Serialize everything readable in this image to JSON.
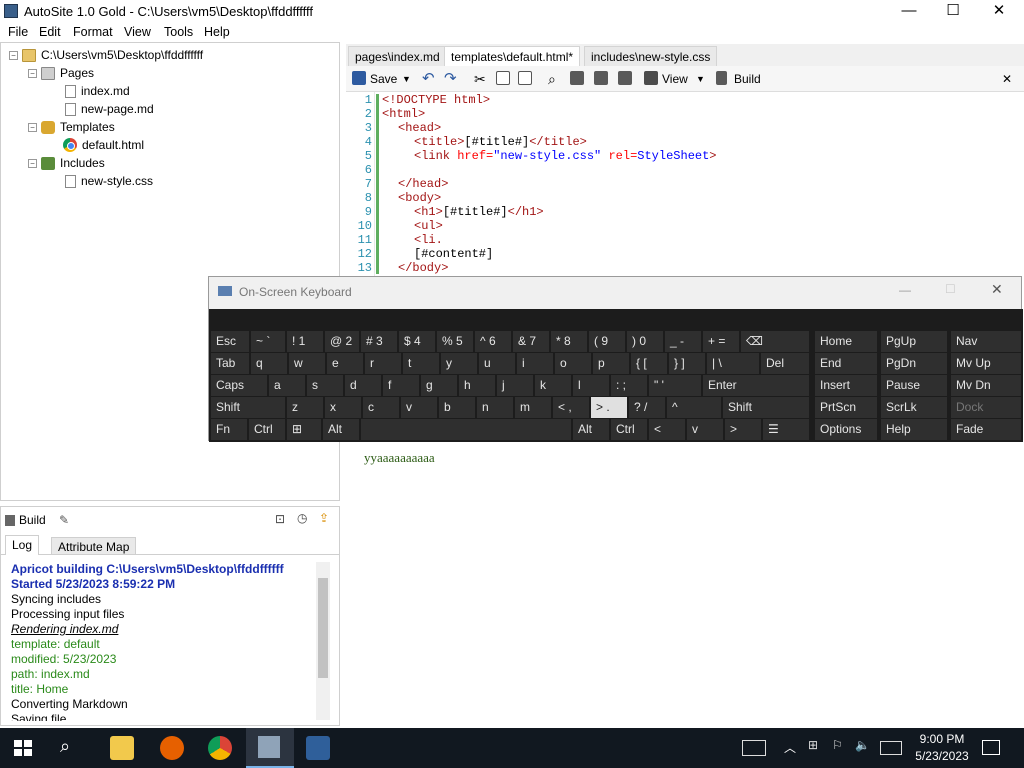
{
  "window": {
    "title": "AutoSite 1.0 Gold - C:\\Users\\vm5\\Desktop\\ffddffffff",
    "min": "—",
    "max": "☐",
    "close": "✕"
  },
  "menu": [
    "File",
    "Edit",
    "Format",
    "View",
    "Tools",
    "Help"
  ],
  "tree": {
    "root": "C:\\Users\\vm5\\Desktop\\ffddffffff",
    "pages": "Pages",
    "index": "index.md",
    "newpage": "new-page.md",
    "templates": "Templates",
    "default": "default.html",
    "includes": "Includes",
    "style": "new-style.css"
  },
  "build": {
    "label": "Build",
    "tab_log": "Log",
    "tab_attr": "Attribute Map",
    "lines": [
      "Apricot building C:\\Users\\vm5\\Desktop\\ffddffffff",
      "Started 5/23/2023 8:59:22 PM",
      "Syncing includes",
      "Processing input files",
      "Rendering index.md",
      " template: default",
      " modified: 5/23/2023",
      " path: index.md",
      " title: Home",
      "Converting Markdown",
      "Saving file"
    ]
  },
  "tabs": [
    "pages\\index.md",
    "templates\\default.html*",
    "includes\\new-style.css"
  ],
  "toolbar": {
    "save": "Save",
    "view": "View",
    "build": "Build",
    "close": "✕"
  },
  "code": {
    "numbers": [
      "1",
      "2",
      "3",
      "4",
      "5",
      "6",
      "7",
      "8",
      "9",
      "10",
      "11",
      "12",
      "13"
    ],
    "l1": "<!DOCTYPE html>",
    "l2": "<html>",
    "l3": "<head>",
    "l4a": "<title>",
    "l4b": "[#title#]",
    "l4c": "</title>",
    "l5a": "<link ",
    "l5b": "href=",
    "l5c": "\"new-style.css\"",
    "l5d": " rel=",
    "l5e": "StyleSheet",
    "l5f": ">",
    "l7": "</head>",
    "l8": "<body>",
    "l9a": "<h1>",
    "l9b": "[#title#]",
    "l9c": "</h1>",
    "l10": "<ul>",
    "l11": "<li.",
    "l12": "[#content#]",
    "l13": "</body>"
  },
  "preview": {
    "text": "yyaaaaaaaaaa"
  },
  "osk": {
    "title": "On-Screen Keyboard",
    "row1": [
      "Esc",
      "~ `",
      "! 1",
      "@ 2",
      "# 3",
      "$ 4",
      "% 5",
      "^ 6",
      "& 7",
      "* 8",
      "( 9",
      ") 0",
      "_ -",
      "+ =",
      "⌫"
    ],
    "row2": [
      "Tab",
      "q",
      "w",
      "e",
      "r",
      "t",
      "y",
      "u",
      "i",
      "o",
      "p",
      "{ [",
      "} ]",
      "| \\",
      "Del"
    ],
    "row3": [
      "Caps",
      "a",
      "s",
      "d",
      "f",
      "g",
      "h",
      "j",
      "k",
      "l",
      ": ;",
      "\" '",
      "Enter"
    ],
    "row4": [
      "Shift",
      "z",
      "x",
      "c",
      "v",
      "b",
      "n",
      "m",
      "< ,",
      "> .",
      "? /",
      "^",
      "Shift"
    ],
    "row5": [
      "Fn",
      "Ctrl",
      "⊞",
      "Alt",
      "",
      "Alt",
      "Ctrl",
      "<",
      "v",
      ">",
      "☰"
    ],
    "nav": [
      [
        "Home",
        "PgUp",
        "Nav"
      ],
      [
        "End",
        "PgDn",
        "Mv Up"
      ],
      [
        "Insert",
        "Pause",
        "Mv Dn"
      ],
      [
        "PrtScn",
        "ScrLk",
        "Dock"
      ],
      [
        "Options",
        "Help",
        "Fade"
      ]
    ]
  },
  "clock": {
    "time": "9:00 PM",
    "date": "5/23/2023"
  }
}
